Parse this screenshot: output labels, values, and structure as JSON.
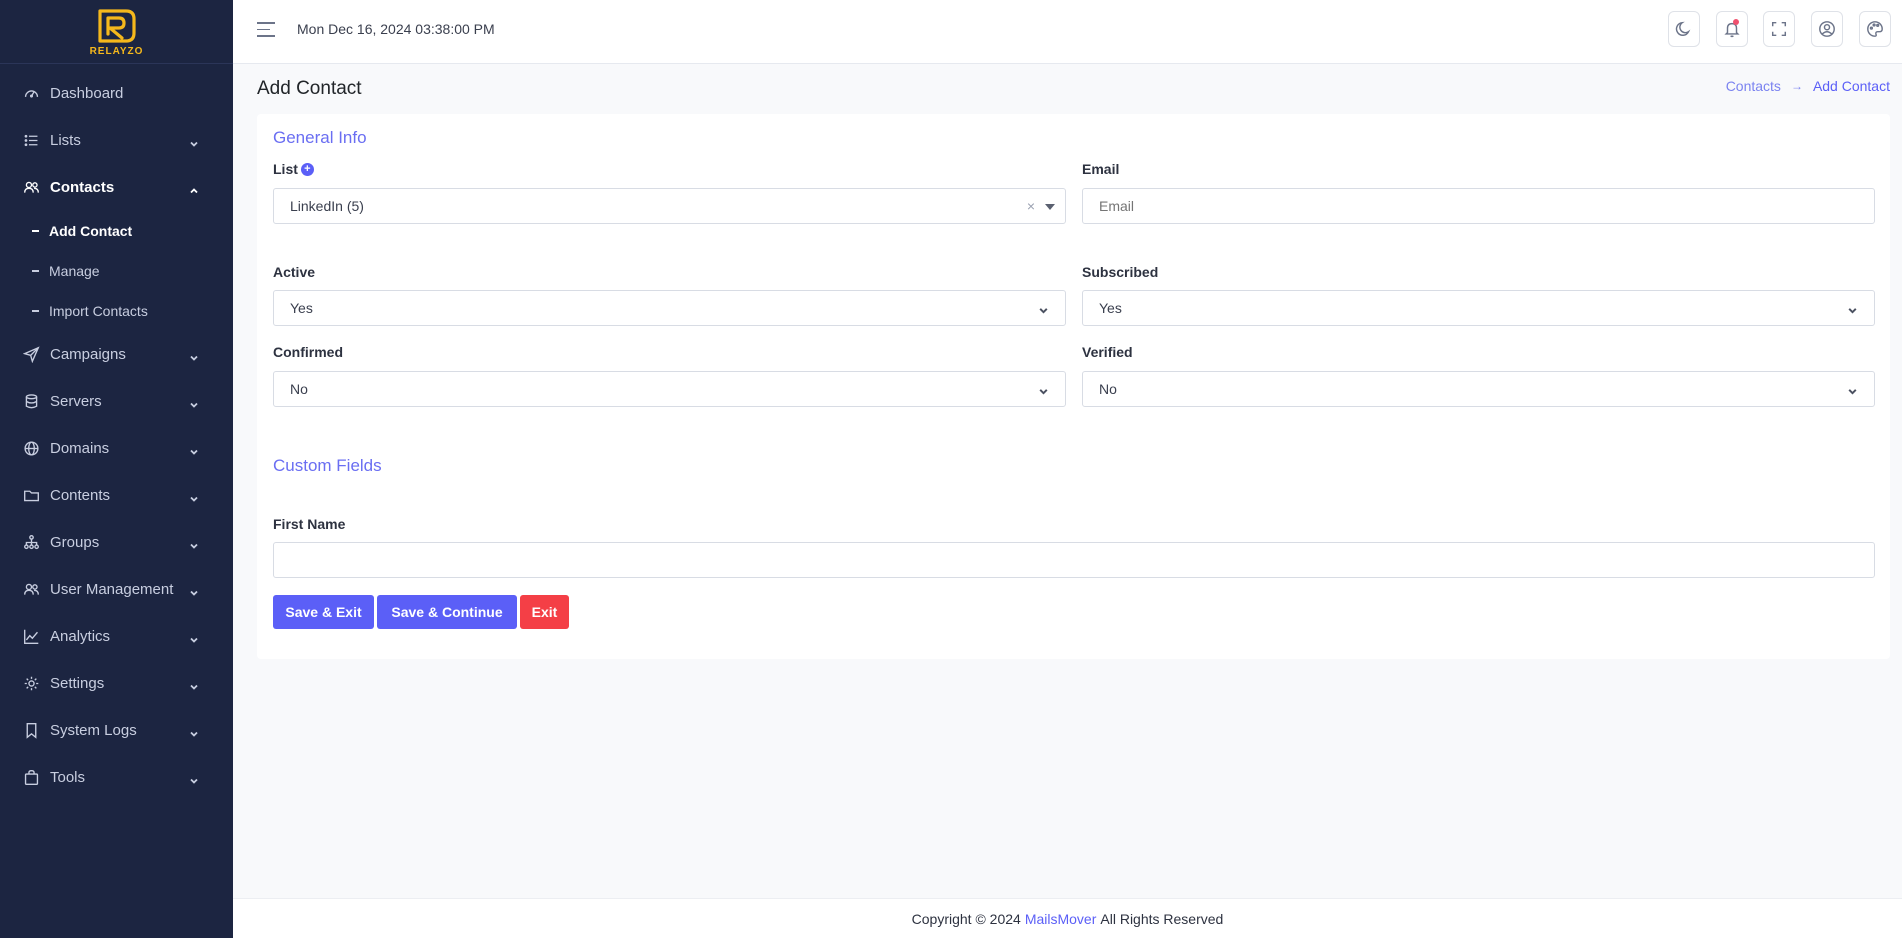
{
  "brand": {
    "logo_text": "RELAYZO",
    "accent": "#5b5ff7",
    "sidebar_bg": "#1c2541",
    "logo_color": "#f5b81c"
  },
  "sidebar": {
    "items": [
      {
        "label": "Dashboard",
        "icon": "gauge-icon"
      },
      {
        "label": "Lists",
        "icon": "list-icon"
      },
      {
        "label": "Contacts",
        "icon": "users-icon",
        "expanded": true
      },
      {
        "label": "Campaigns",
        "icon": "send-icon"
      },
      {
        "label": "Servers",
        "icon": "database-icon"
      },
      {
        "label": "Domains",
        "icon": "globe-icon"
      },
      {
        "label": "Contents",
        "icon": "folder-icon"
      },
      {
        "label": "Groups",
        "icon": "sitemap-icon"
      },
      {
        "label": "User Management",
        "icon": "user-group-icon"
      },
      {
        "label": "Analytics",
        "icon": "chart-line-icon"
      },
      {
        "label": "Settings",
        "icon": "gear-icon"
      },
      {
        "label": "System Logs",
        "icon": "bookmark-icon"
      },
      {
        "label": "Tools",
        "icon": "bag-icon"
      }
    ],
    "contacts_sub": [
      {
        "label": "Add Contact",
        "active": true
      },
      {
        "label": "Manage"
      },
      {
        "label": "Import Contacts"
      }
    ]
  },
  "topbar": {
    "datetime": "Mon Dec 16, 2024 03:38:00 PM",
    "icons": [
      "moon-icon",
      "bell-icon",
      "fullscreen-icon",
      "user-circle-icon",
      "palette-icon"
    ]
  },
  "page": {
    "title": "Add Contact",
    "breadcrumb": {
      "parent": "Contacts",
      "arrow": "→",
      "current": "Add Contact"
    }
  },
  "form": {
    "general_info_title": "General Info",
    "list_label": "List",
    "list_plus": "+",
    "list_value": "LinkedIn (5)",
    "list_clear": "×",
    "email_label": "Email",
    "email_placeholder": "Email",
    "active_label": "Active",
    "active_value": "Yes",
    "subscribed_label": "Subscribed",
    "subscribed_value": "Yes",
    "confirmed_label": "Confirmed",
    "confirmed_value": "No",
    "verified_label": "Verified",
    "verified_value": "No",
    "custom_fields_title": "Custom Fields",
    "first_name_label": "First Name",
    "first_name_value": ""
  },
  "buttons": {
    "save_exit": "Save & Exit",
    "save_continue": "Save & Continue",
    "exit": "Exit"
  },
  "footer": {
    "prefix": "Copyright © 2024",
    "brand": "MailsMover",
    "suffix": "All Rights Reserved"
  }
}
